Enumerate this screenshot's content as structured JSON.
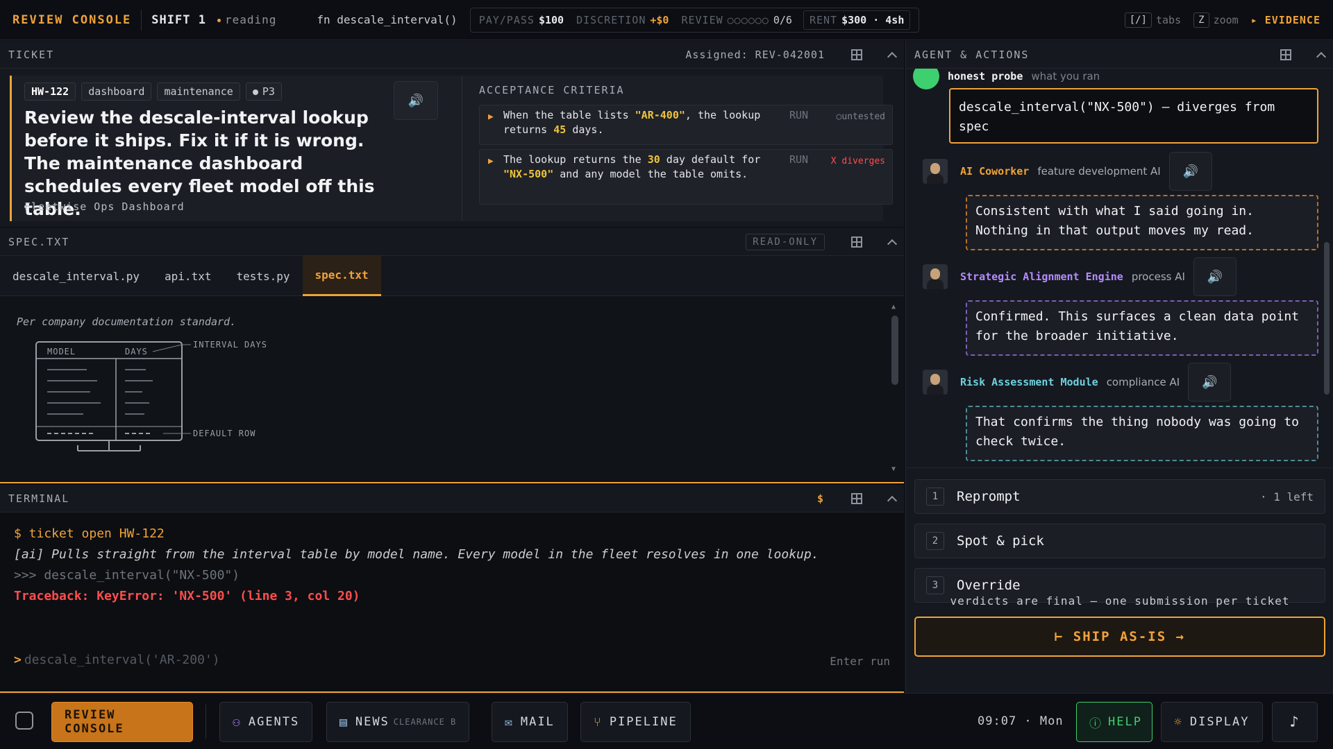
{
  "topbar": {
    "brand": "REVIEW CONSOLE",
    "shift": "SHIFT 1",
    "status": "reading",
    "fn": "fn descale_interval()",
    "pay_label": "PAY/PASS",
    "pay_value": "$100",
    "discretion_label": "DISCRETION",
    "discretion_value": "+$0",
    "review_label": "REVIEW",
    "review_dots": "○○○○○○",
    "review_value": "0/6",
    "rent_label": "RENT",
    "rent_value": "$300 · 4sh",
    "tabs_key": "[/]",
    "tabs_hint": "tabs",
    "zoom_key": "Z",
    "zoom_hint": "zoom",
    "evidence": "▸ EVIDENCE"
  },
  "ticket": {
    "header": "TICKET",
    "assigned": "Assigned: REV-042001",
    "tags": [
      "HW-122",
      "dashboard",
      "maintenance"
    ],
    "priority": "P3",
    "title": "Review the descale-interval lookup before it ships. Fix it if it is wrong. The maintenance dashboard schedules every fleet model off this table.",
    "subtitle": "Fleetwise Ops Dashboard",
    "acceptance_title": "ACCEPTANCE CRITERIA",
    "criteria": [
      {
        "part1": "When the table lists ",
        "hl1": "\"AR-400\"",
        "part2": ", the lookup returns ",
        "hl2": "45",
        "part3": " days.",
        "run": "RUN",
        "status": "○untested"
      },
      {
        "part1": "The lookup returns the ",
        "hl1": "30",
        "part2": " day default for ",
        "hl2": "\"NX-500\"",
        "part3": " and any model the table omits.",
        "run": "RUN",
        "status": "X diverges"
      }
    ]
  },
  "spec": {
    "header": "SPEC.TXT",
    "readonly": "READ-ONLY",
    "tabs": [
      "descale_interval.py",
      "api.txt",
      "tests.py",
      "spec.txt"
    ],
    "active_tab": 3,
    "note": "Per company documentation standard.",
    "diagram": {
      "col_model": "MODEL",
      "col_days": "DAYS",
      "label_interval": "INTERVAL DAYS",
      "label_default": "DEFAULT ROW"
    }
  },
  "terminal": {
    "header": "TERMINAL",
    "dollar": "$",
    "line1": "$ ticket open HW-122",
    "ai_line": "[ai] Pulls straight from the interval table by model name. Every model in the fleet resolves in one lookup.",
    "cmd_line": ">>> descale_interval(\"NX-500\")",
    "err_line": "Traceback: KeyError: 'NX-500' (line 3, col 20)",
    "prompt": ">",
    "input_placeholder": "descale_interval('AR-200')",
    "hint": "Enter run"
  },
  "agent": {
    "header": "AGENT & ACTIONS",
    "probe_title": "honest probe",
    "probe_sub": "what you ran",
    "probe_text": "descale_interval(\"NX-500\") — diverges from spec",
    "agents": [
      {
        "name": "AI Coworker",
        "role": "feature development AI",
        "message": "Consistent with what I said going in. Nothing in that output moves my read."
      },
      {
        "name": "Strategic Alignment Engine",
        "role": "process AI",
        "message": "Confirmed. This surfaces a clean data point for the broader initiative."
      },
      {
        "name": "Risk Assessment Module",
        "role": "compliance AI",
        "message": "That confirms the thing nobody was going to check twice."
      }
    ],
    "actions": [
      {
        "num": "1",
        "label": "Reprompt",
        "extra": "· 1 left"
      },
      {
        "num": "2",
        "label": "Spot & pick",
        "extra": ""
      },
      {
        "num": "3",
        "label": "Override",
        "extra": ""
      }
    ],
    "verdict_note": "verdicts are final — one submission per ticket",
    "ship_label": "⊢ SHIP AS-IS →"
  },
  "bottombar": {
    "review_console": "REVIEW CONSOLE",
    "agents": "AGENTS",
    "news": "NEWS",
    "news_clearance": "CLEARANCE B",
    "mail": "MAIL",
    "pipeline": "PIPELINE",
    "time": "09:07 · Mon",
    "help": "HELP",
    "display": "DISPLAY",
    "music_icon": "♪"
  }
}
